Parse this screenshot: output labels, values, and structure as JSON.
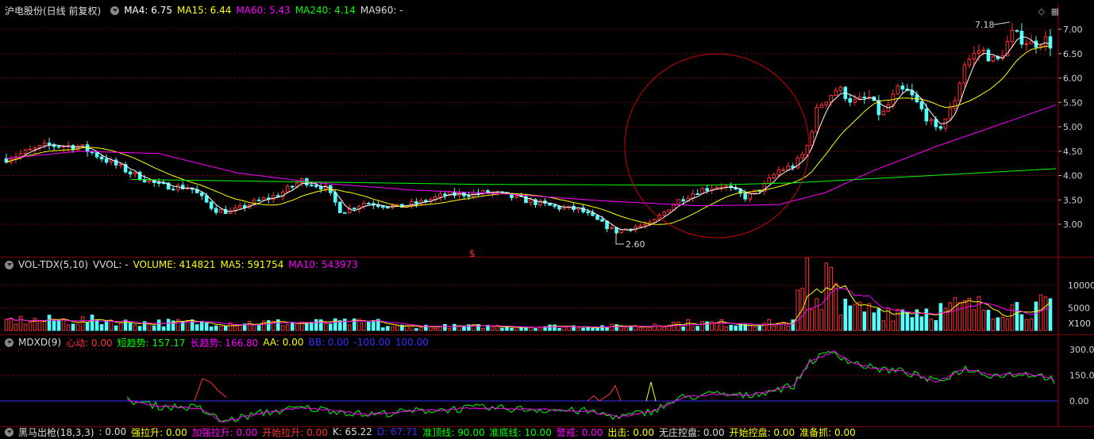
{
  "main": {
    "title": "沪电股份(日线 前复权)",
    "ma4": "MA4: 6.75",
    "ma15": "MA15: 6.44",
    "ma60": "MA60: 5.43",
    "ma240": "MA240: 4.14",
    "ma960": "MA960: -",
    "price_ticks": [
      "7.00",
      "6.50",
      "6.00",
      "5.50",
      "5.00",
      "4.50",
      "4.00",
      "3.50",
      "3.00"
    ],
    "high_label": "7.18",
    "low_label": "2.60",
    "signal_mark": "$",
    "toolbar_icons": [
      "diamond-icon",
      "grid-icon"
    ],
    "colors": {
      "up": "#ff3232",
      "down": "#54ffff",
      "ma4": "#ffffff",
      "ma15": "#ffff00",
      "ma60": "#ff00ff",
      "ma240": "#00ff00",
      "grid": "#7a0000"
    }
  },
  "volume": {
    "name": "VOL-TDX(5,10)",
    "vvol": "VVOL: -",
    "volume": "VOLUME: 414821",
    "ma5": "MA5: 591754",
    "ma10": "MA10: 543973",
    "ticks": [
      "10000",
      "5000"
    ],
    "unit": "X100"
  },
  "mdxd": {
    "name": "MDXD(9)",
    "xindong": "心动: 0.00",
    "short": "短趋势: 157.17",
    "long": "长趋势: 166.80",
    "aa": "AA: 0.00",
    "bb": "BB: 0.00",
    "v1": "-100.00",
    "v2": "100.00",
    "ticks": [
      "300.00",
      "150.00",
      "0.00"
    ]
  },
  "bottom": {
    "name": "黑马出枪(18,3,3)",
    "items": [
      ": 0.00",
      "强拉升: 0.00",
      "加强拉升: 0.00",
      "开始拉升: 0.00",
      "K: 65.22",
      "D: 67.71",
      "准顶线: 90.00",
      "准底线: 10.00",
      "警戒: 0.00",
      "出击: 0.00",
      "无庄控盘: 0.00",
      "开始控盘: 0.00",
      "准备抓: 0.00"
    ]
  }
}
